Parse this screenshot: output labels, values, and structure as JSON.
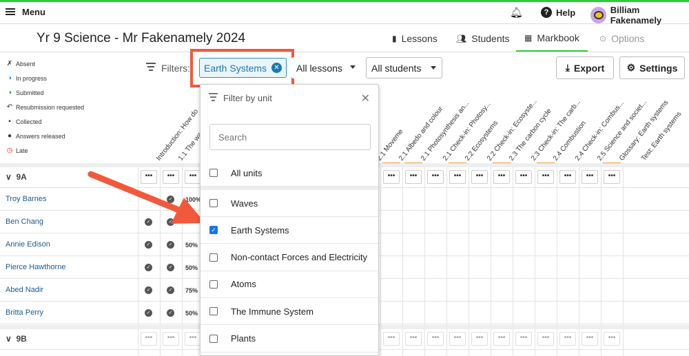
{
  "topbar": {
    "menu_label": "Menu",
    "help_label": "Help",
    "user_name": "Billiam Fakenamely"
  },
  "page": {
    "title": "Yr 9 Science - Mr Fakenamely 2024"
  },
  "nav": {
    "lessons": "Lessons",
    "students": "Students",
    "markbook": "Markbook",
    "options": "Options",
    "active": "Markbook"
  },
  "legend": {
    "absent": "Absent",
    "in_progress": "In progress",
    "submitted": "Submitted",
    "resubmission": "Resubmission requested",
    "collected": "Collected",
    "answers_released": "Answers released",
    "late": "Late"
  },
  "filters": {
    "label": "Filters:",
    "chip": "Earth Systems",
    "lessons_select": "All lessons",
    "students_select": "All students",
    "export": "Export",
    "settings": "Settings"
  },
  "columns": [
    "Introduction: How do",
    "1.1 The wa",
    "",
    "",
    "",
    "",
    "",
    "",
    "",
    "",
    "2.1 Moveme",
    "2.1 Albedo and colour",
    "2.1 Photosynthesis an...",
    "2.1 Check-in: Photosy...",
    "2.2 Ecosystems",
    "2.2 Check-in: Ecosyste...",
    "2.3 The carbon cycle",
    "2.3 Check-in: The carb...",
    "2.4 Combustion",
    "2.4 Check-in: Combus...",
    "2.5 Science and societ...",
    "Glossary: Earth systems",
    "Test: Earth systems"
  ],
  "groups": [
    {
      "label": "9A"
    },
    {
      "label": "9B"
    }
  ],
  "students": [
    {
      "name": "Troy Barnes",
      "pct": "100%"
    },
    {
      "name": "Ben Chang",
      "pct": ""
    },
    {
      "name": "Annie Edison",
      "pct": "50%"
    },
    {
      "name": "Pierce Hawthorne",
      "pct": "50%"
    },
    {
      "name": "Abed Nadir",
      "pct": "75%"
    },
    {
      "name": "Britta Perry",
      "pct": "50%"
    }
  ],
  "dropdown": {
    "title": "Filter by unit",
    "search_placeholder": "Search",
    "all_units": "All units",
    "options": [
      {
        "label": "Waves",
        "checked": false
      },
      {
        "label": "Earth Systems",
        "checked": true
      },
      {
        "label": "Non-contact Forces and Electricity",
        "checked": false
      },
      {
        "label": "Atoms",
        "checked": false
      },
      {
        "label": "The Immune System",
        "checked": false
      },
      {
        "label": "Plants",
        "checked": false
      }
    ]
  },
  "colors": {
    "accent_green": "#2ecc40",
    "chip_blue": "#1a7ab2",
    "highlight_red": "#f2593c",
    "orange_bar": "#f39c33"
  }
}
